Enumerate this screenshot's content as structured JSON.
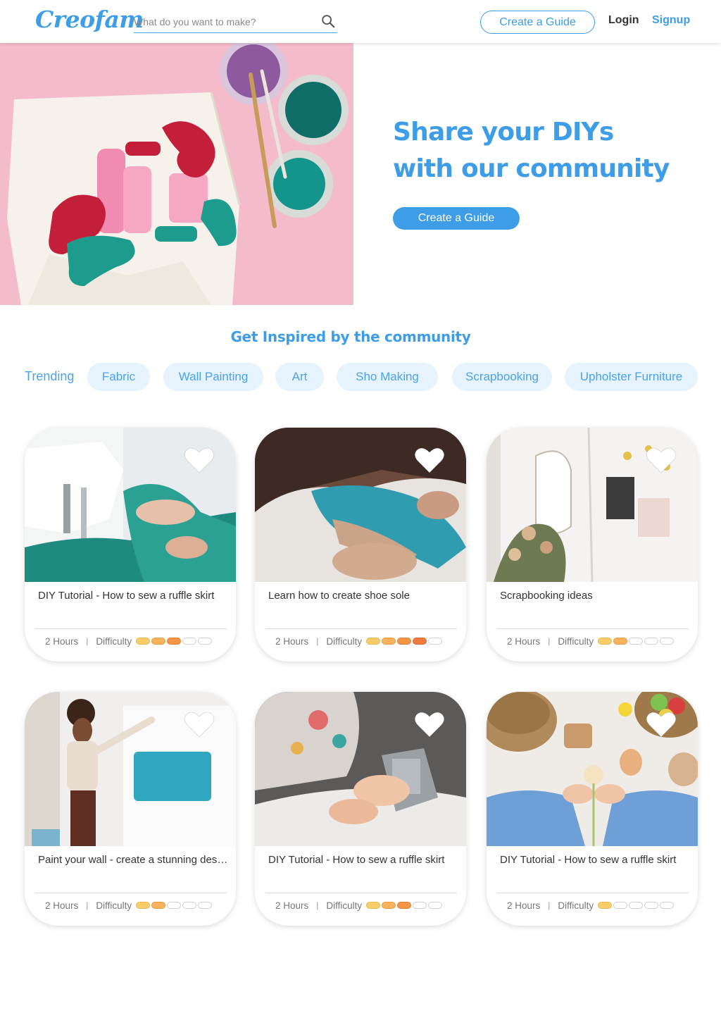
{
  "header": {
    "logo": "Creofam",
    "search_placeholder": "What do you want to make?",
    "create_guide": "Create a Guide",
    "login": "Login",
    "signup": "Signup"
  },
  "hero": {
    "title_line1": "Share your DIYs",
    "title_line2": "with our community",
    "button": "Create a Guide"
  },
  "inspired": {
    "title": "Get Inspired by the community",
    "trending": "Trending",
    "categories": [
      "Fabric",
      "Wall Painting",
      "Art",
      "Sho Making",
      "Scrapbooking",
      "Upholster Furniture"
    ]
  },
  "cards": [
    {
      "title": "DIY Tutorial - How to sew a ruffle skirt",
      "duration": "2 Hours",
      "difficulty_label": "Difficulty",
      "difficulty": 3,
      "image": "sewing-machine-green-fabric"
    },
    {
      "title": "Learn how to create shoe sole",
      "duration": "2 Hours",
      "difficulty_label": "Difficulty",
      "difficulty": 4,
      "image": "shoe-making-blue-leather"
    },
    {
      "title": "Scrapbooking ideas",
      "duration": "2 Hours",
      "difficulty_label": "Difficulty",
      "difficulty": 2,
      "image": "scrapbook-dried-flowers"
    },
    {
      "title": "Paint your wall - create a stunning design",
      "duration": "2 Hours",
      "difficulty_label": "Difficulty",
      "difficulty": 2,
      "image": "woman-painting-wall"
    },
    {
      "title": "DIY Tutorial - How to sew a ruffle skirt",
      "duration": "2 Hours",
      "difficulty_label": "Difficulty",
      "difficulty": 3,
      "image": "stapler-upholstery"
    },
    {
      "title": "DIY Tutorial - How to sew a ruffle skirt",
      "duration": "2 Hours",
      "difficulty_label": "Difficulty",
      "difficulty": 1,
      "image": "easter-crafts"
    }
  ],
  "colors": {
    "accent": "#3d9de6",
    "chip_bg": "#e6f3fd",
    "difficulty": [
      "#f7cd6b",
      "#f6b25c",
      "#f39545",
      "#ef7a3d"
    ]
  }
}
